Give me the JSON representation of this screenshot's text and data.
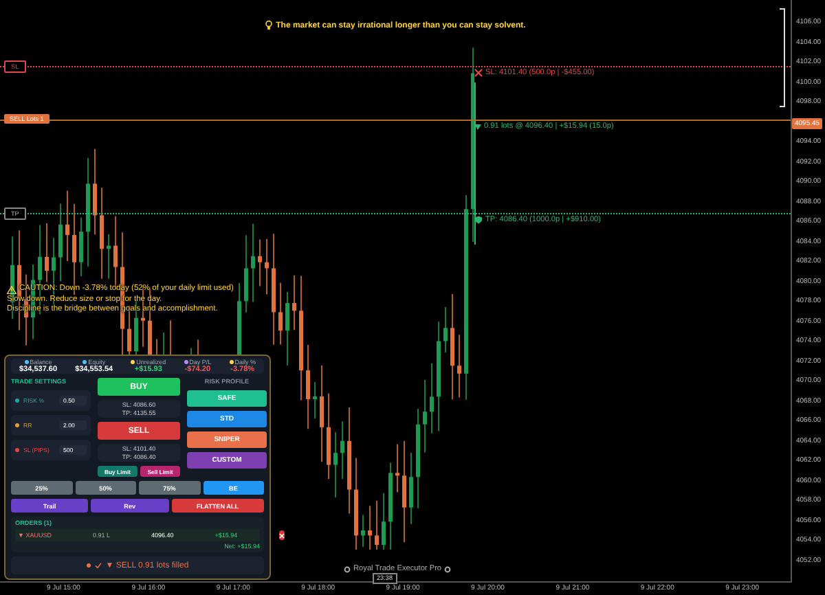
{
  "banner": {
    "text": "The market can stay irrational longer than you can stay solvent."
  },
  "price_axis": [
    {
      "label": "4106.00",
      "kind": "tick"
    },
    {
      "label": "4104.00",
      "kind": "tick"
    },
    {
      "label": "4102.00",
      "kind": "tick"
    },
    {
      "label": "4100.00",
      "kind": "tick"
    },
    {
      "label": "4098.00",
      "kind": "tick"
    },
    {
      "label": "4095.45",
      "kind": "current"
    },
    {
      "label": "4094.00",
      "kind": "tick"
    },
    {
      "label": "4092.00",
      "kind": "tick"
    },
    {
      "label": "4090.00",
      "kind": "tick"
    },
    {
      "label": "4088.00",
      "kind": "tick"
    },
    {
      "label": "4086.00",
      "kind": "tick"
    },
    {
      "label": "4084.00",
      "kind": "tick"
    },
    {
      "label": "4082.00",
      "kind": "tick"
    },
    {
      "label": "4080.00",
      "kind": "tick"
    },
    {
      "label": "4078.00",
      "kind": "tick"
    },
    {
      "label": "4076.00",
      "kind": "tick"
    },
    {
      "label": "4074.00",
      "kind": "tick"
    },
    {
      "label": "4072.00",
      "kind": "tick"
    },
    {
      "label": "4070.00",
      "kind": "tick"
    },
    {
      "label": "4068.00",
      "kind": "tick"
    },
    {
      "label": "4066.00",
      "kind": "tick"
    },
    {
      "label": "4064.00",
      "kind": "tick"
    },
    {
      "label": "4062.00",
      "kind": "tick"
    },
    {
      "label": "4060.00",
      "kind": "tick"
    },
    {
      "label": "4058.00",
      "kind": "tick"
    },
    {
      "label": "4056.00",
      "kind": "tick"
    },
    {
      "label": "4054.00",
      "kind": "tick"
    },
    {
      "label": "4052.00",
      "kind": "tick"
    }
  ],
  "time_axis": [
    "9 Jul 15:00",
    "9 Jul 16:00",
    "9 Jul 17:00",
    "9 Jul 18:00",
    "9 Jul 19:00",
    "9 Jul 20:00",
    "9 Jul 21:00",
    "9 Jul 22:00",
    "9 Jul 23:00"
  ],
  "crosshair_time": "23:38",
  "lines": [
    {
      "kind": "sl",
      "tag": "SL",
      "label": "SL: 4101.40 (500.0p | -$455.00)"
    },
    {
      "kind": "entry",
      "tag": "SELL Lots 1",
      "label": "0.91 lots @ 4096.40 | +$15.94 (15.0p)"
    },
    {
      "kind": "tp",
      "tag": "TP",
      "label": "TP: 4086.40 (1000.0p | +$910.00)"
    }
  ],
  "caution": {
    "title": "CAUTION: Down -3.78% today (52% of your daily limit used)",
    "lines": [
      "Slow down. Reduce size or stop for the day.",
      "Discipline is the bridge between goals and accomplishment."
    ]
  },
  "footer": "Royal Trade Executor Pro",
  "panel": {
    "stats": [
      {
        "label": "Balance",
        "value": "$34,537.60",
        "color": "#4fc3f7",
        "kind": "balance"
      },
      {
        "label": "Equity",
        "value": "$34,553.54",
        "color": "#4fc3f7",
        "kind": "equity"
      },
      {
        "label": "Unrealized",
        "value": "+$15.93",
        "color": "#ffd54f",
        "kind": "gain"
      },
      {
        "label": "Day P/L",
        "value": "-$74.20",
        "color": "#b388ff",
        "kind": "loss"
      },
      {
        "label": "Daily %",
        "value": "-3.78%",
        "color": "#ffd54f",
        "kind": "loss"
      }
    ],
    "settings": {
      "title": "TRADE SETTINGS",
      "rows": [
        {
          "label": "RISK %",
          "value": "0.50",
          "color": "#26a69a"
        },
        {
          "label": "RR",
          "value": "2.00",
          "color": "#e0a030"
        },
        {
          "label": "SL (PIPS)",
          "value": "500",
          "color": "#e04848"
        }
      ]
    },
    "buy": {
      "label": "BUY",
      "levels": [
        "SL: 4086.60",
        "TP: 4135.55"
      ]
    },
    "sell": {
      "label": "SELL",
      "levels": [
        "SL: 4101.40",
        "TP: 4086.40"
      ]
    },
    "limits": [
      "Buy Limit",
      "Sell Limit"
    ],
    "profiles": {
      "title": "RISK PROFILE",
      "items": [
        {
          "label": "SAFE",
          "kind": "safe"
        },
        {
          "label": "STD",
          "kind": "std"
        },
        {
          "label": "SNIPER",
          "kind": "sniper"
        },
        {
          "label": "CUSTOM",
          "kind": "custom"
        }
      ]
    },
    "partials": [
      {
        "label": "25%",
        "kind": "partial"
      },
      {
        "label": "50%",
        "kind": "partial"
      },
      {
        "label": "75%",
        "kind": "partial"
      },
      {
        "label": "BE",
        "kind": "breakeven"
      }
    ],
    "actions": [
      {
        "label": "Trail",
        "kind": "trail"
      },
      {
        "label": "Rev",
        "kind": "reverse"
      },
      {
        "label": "FLATTEN ALL",
        "kind": "flatten"
      }
    ],
    "orders": {
      "title": "ORDERS (1)",
      "rows": [
        {
          "symbol": "▼ XAUUSD",
          "lots": "0.91 L",
          "price": "4096.40",
          "pnl": "+$15.94"
        }
      ],
      "net": "Net: +$15.94"
    },
    "status": "▼ SELL 0.91 lots filled"
  }
}
